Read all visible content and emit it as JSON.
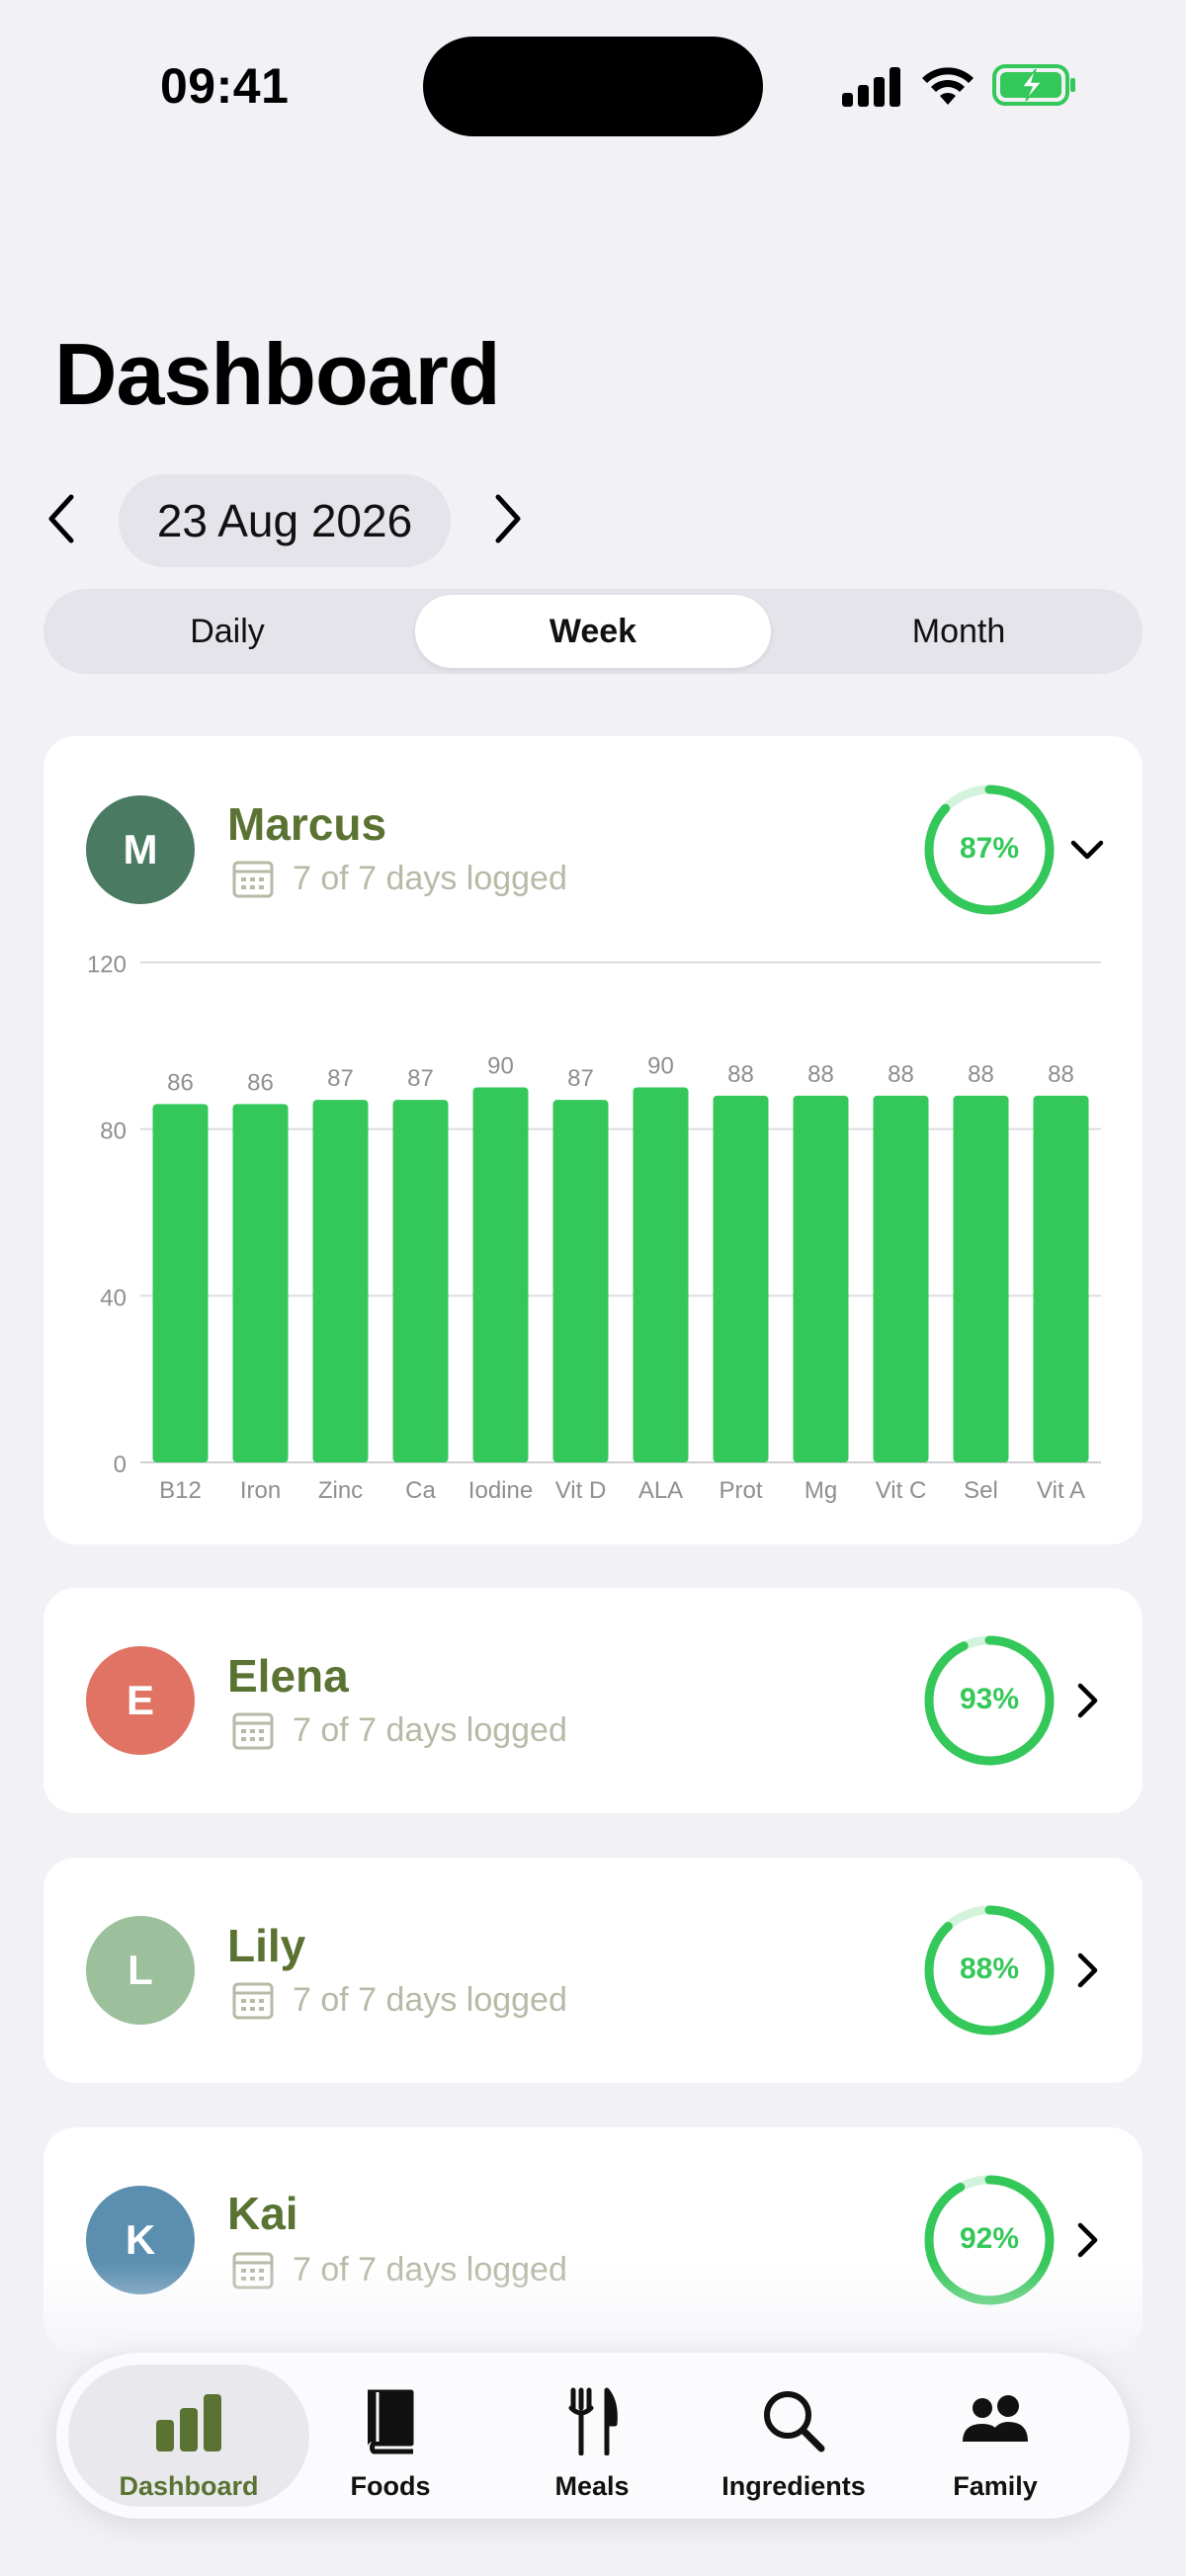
{
  "status": {
    "time": "09:41"
  },
  "header": {
    "title": "Dashboard"
  },
  "date_nav": {
    "date": "23 Aug 2026"
  },
  "segments": [
    "Daily",
    "Week",
    "Month"
  ],
  "active_segment": "Week",
  "members": [
    {
      "initial": "M",
      "name": "Marcus",
      "logged": "7 of 7 days logged",
      "percent": "87%",
      "progress": 0.87,
      "color": "#4a7a62",
      "expanded": true
    },
    {
      "initial": "E",
      "name": "Elena",
      "logged": "7 of 7 days logged",
      "percent": "93%",
      "progress": 0.93,
      "color": "#e07364",
      "expanded": false
    },
    {
      "initial": "L",
      "name": "Lily",
      "logged": "7 of 7 days logged",
      "percent": "88%",
      "progress": 0.88,
      "color": "#9cbf9c",
      "expanded": false
    },
    {
      "initial": "K",
      "name": "Kai",
      "logged": "7 of 7 days logged",
      "percent": "92%",
      "progress": 0.92,
      "color": "#5b8fb0",
      "expanded": false
    }
  ],
  "chart_data": {
    "type": "bar",
    "categories": [
      "B12",
      "Iron",
      "Zinc",
      "Ca",
      "Iodine",
      "Vit D",
      "ALA",
      "Prot",
      "Mg",
      "Vit C",
      "Sel",
      "Vit A"
    ],
    "values": [
      86,
      86,
      87,
      87,
      90,
      87,
      90,
      88,
      88,
      88,
      88,
      88
    ],
    "yticks": [
      0,
      40,
      80,
      120
    ],
    "ylim": [
      0,
      120
    ],
    "color": "#34c759",
    "grid": true,
    "title": "",
    "xlabel": "",
    "ylabel": ""
  },
  "tabs": [
    {
      "label": "Dashboard",
      "icon": "chart-bars-icon",
      "active": true
    },
    {
      "label": "Foods",
      "icon": "book-icon",
      "active": false
    },
    {
      "label": "Meals",
      "icon": "fork-knife-icon",
      "active": false
    },
    {
      "label": "Ingredients",
      "icon": "search-icon",
      "active": false
    },
    {
      "label": "Family",
      "icon": "people-icon",
      "active": false
    }
  ],
  "colors": {
    "accent": "#34c759",
    "name": "#5a7232",
    "muted": "#b7baa6",
    "background": "#f2f1f6"
  }
}
